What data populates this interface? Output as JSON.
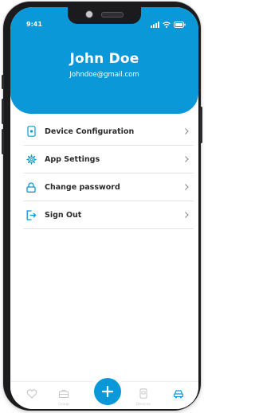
{
  "status_bar": {
    "time": "9:41"
  },
  "profile": {
    "name": "John Doe",
    "email": "Johndoe@gmail.com"
  },
  "menu": [
    {
      "label": "Device Configuration",
      "icon": "device-icon"
    },
    {
      "label": "App Settings",
      "icon": "gear-icon"
    },
    {
      "label": "Change password",
      "icon": "lock-icon"
    },
    {
      "label": "Sign Out",
      "icon": "sign-out-icon"
    }
  ],
  "bottom_nav": [
    {
      "label": "",
      "icon": "heart-icon"
    },
    {
      "label": "Group",
      "icon": "group-icon"
    },
    {
      "label": "",
      "icon": "plus-icon"
    },
    {
      "label": "Devices",
      "icon": "phone-icon"
    },
    {
      "label": "",
      "icon": "car-icon"
    }
  ],
  "colors": {
    "accent": "#0a98d8",
    "text": "#2b2b2b",
    "divider": "#e3e3e3",
    "inactive": "#c9c9c9"
  }
}
